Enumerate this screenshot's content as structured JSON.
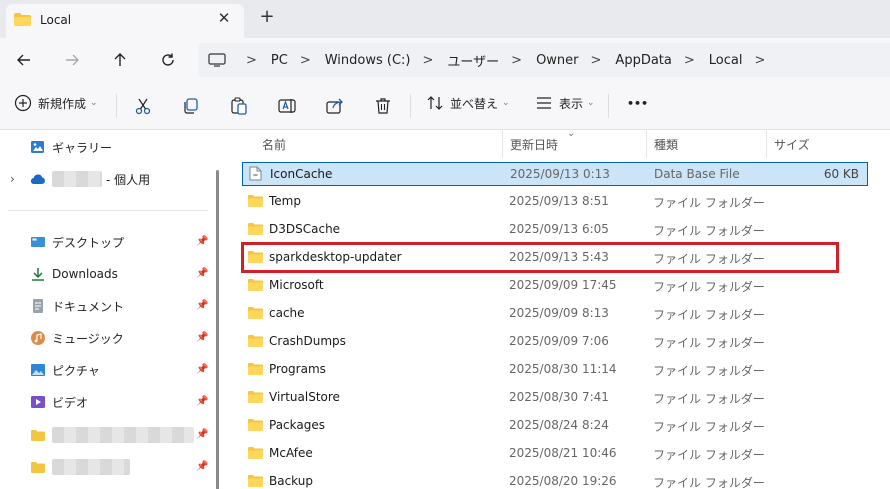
{
  "tab": {
    "title": "Local",
    "close": "✕",
    "new": "+"
  },
  "address": {
    "crumbs": [
      "PC",
      "Windows (C:)",
      "ユーザー",
      "Owner",
      "AppData",
      "Local"
    ],
    "separator": ">"
  },
  "toolbar": {
    "new_label": "新規作成",
    "sort_label": "並べ替え",
    "view_label": "表示",
    "more": "•••"
  },
  "sidebar": {
    "gallery": "ギャラリー",
    "onedrive_suffix": "- 個人用",
    "quick": [
      "デスクトップ",
      "Downloads",
      "ドキュメント",
      "ミュージック",
      "ピクチャ",
      "ビデオ"
    ]
  },
  "columns": {
    "name": "名前",
    "date": "更新日時",
    "type": "種類",
    "size": "サイズ"
  },
  "files": [
    {
      "name": "IconCache",
      "date": "2025/09/13 0:13",
      "type": "Data Base File",
      "size": "60 KB"
    },
    {
      "name": "Temp",
      "date": "2025/09/13 8:51",
      "type": "ファイル フォルダー",
      "size": ""
    },
    {
      "name": "D3DSCache",
      "date": "2025/09/13 6:05",
      "type": "ファイル フォルダー",
      "size": ""
    },
    {
      "name": "sparkdesktop-updater",
      "date": "2025/09/13 5:43",
      "type": "ファイル フォルダー",
      "size": ""
    },
    {
      "name": "Microsoft",
      "date": "2025/09/09 17:45",
      "type": "ファイル フォルダー",
      "size": ""
    },
    {
      "name": "cache",
      "date": "2025/09/09 8:13",
      "type": "ファイル フォルダー",
      "size": ""
    },
    {
      "name": "CrashDumps",
      "date": "2025/09/09 7:06",
      "type": "ファイル フォルダー",
      "size": ""
    },
    {
      "name": "Programs",
      "date": "2025/08/30 11:14",
      "type": "ファイル フォルダー",
      "size": ""
    },
    {
      "name": "VirtualStore",
      "date": "2025/08/30 7:41",
      "type": "ファイル フォルダー",
      "size": ""
    },
    {
      "name": "Packages",
      "date": "2025/08/24 8:24",
      "type": "ファイル フォルダー",
      "size": ""
    },
    {
      "name": "McAfee",
      "date": "2025/08/21 10:46",
      "type": "ファイル フォルダー",
      "size": ""
    },
    {
      "name": "Backup",
      "date": "2025/08/20 19:26",
      "type": "ファイル フォルダー",
      "size": ""
    }
  ],
  "colors": {
    "accent": "#0063b1",
    "selection": "#cce4f7",
    "highlight_box": "#d1202a",
    "folder": "#f4c542"
  }
}
